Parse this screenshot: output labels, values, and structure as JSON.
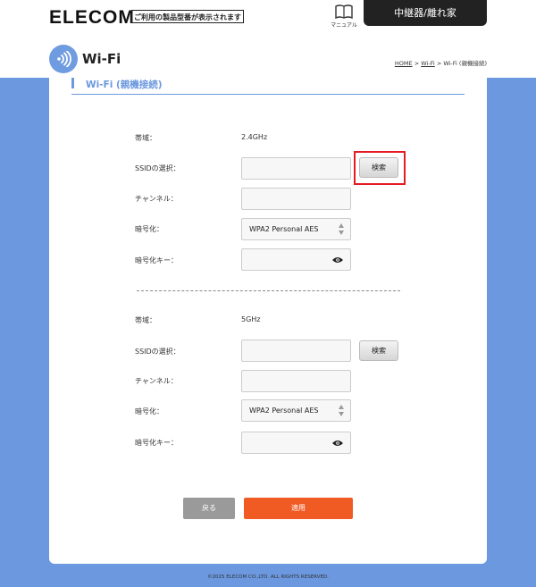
{
  "header": {
    "logo": "ELECOM",
    "tagline": "ご利用の製品型番が表示されます",
    "manual_label": "マニュアル",
    "mode": "中継器/離れ家"
  },
  "page": {
    "title": "Wi-Fi",
    "breadcrumb": {
      "home": "HOME",
      "sep": ">",
      "wifi": "Wi-Fi",
      "current": "Wi-Fi (親機接続)"
    }
  },
  "section": {
    "title": "Wi-Fi (親機接続)"
  },
  "band24": {
    "band_label": "帯域：",
    "band_value": "2.4GHz",
    "ssid_label": "SSIDの選択：",
    "ssid_value": "",
    "search_label": "検索",
    "channel_label": "チャンネル：",
    "channel_value": "",
    "encryption_label": "暗号化：",
    "encryption_value": "WPA2 Personal AES",
    "key_label": "暗号化キー：",
    "key_value": ""
  },
  "band5": {
    "band_label": "帯域：",
    "band_value": "5GHz",
    "ssid_label": "SSIDの選択：",
    "ssid_value": "",
    "search_label": "検索",
    "channel_label": "チャンネル：",
    "channel_value": "",
    "encryption_label": "暗号化：",
    "encryption_value": "WPA2 Personal AES",
    "key_label": "暗号化キー：",
    "key_value": ""
  },
  "actions": {
    "back": "戻る",
    "apply": "適用"
  },
  "footer": "©2025 ELECOM CO.,LTD. ALL RIGHTS RESERVED.",
  "colors": {
    "background": "#6b98df",
    "apply": "#f05a23",
    "back": "#9a9a9a",
    "highlight": "#e41b23"
  },
  "icons": {
    "wifi": "wifi-icon",
    "manual": "book-icon",
    "eye": "eye-icon",
    "select": "updown-arrows-icon"
  }
}
